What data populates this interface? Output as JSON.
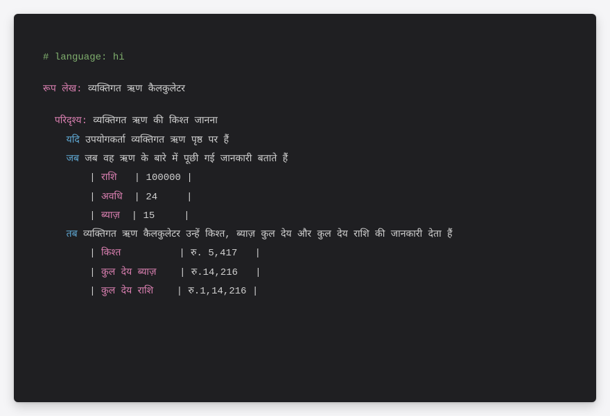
{
  "comment": "# language: hi",
  "feature_kw": "रूप लेख:",
  "feature_title": " व्यक्तिगत ऋण कैलकुलेटर",
  "scenario_kw": "परिदृश्य:",
  "scenario_title": " व्यक्तिगत ऋण की किश्त जानना",
  "given_kw": "यदि",
  "given_text": " उपयोगकर्ता व्यक्तिगत ऋण पृष्ठ पर हैं",
  "when_kw": "जब",
  "when_text": " जब वह ऋण के बारे में पूछी गई जानकारी बताते हैं",
  "table1": {
    "r1": {
      "name": " राशि   ",
      "val": " 100000 "
    },
    "r2": {
      "name": " अवधि  ",
      "val": " 24     "
    },
    "r3": {
      "name": " ब्याज़  ",
      "val": " 15     "
    }
  },
  "then_kw": "तब",
  "then_text": " व्यक्तिगत ऋण कैलकुलेटर उन्हें किश्त, ब्याज़ कुल देय और कुल देय राशि की जानकारी देता हैं",
  "table2": {
    "r1": {
      "name": " किश्त          ",
      "val": " रु. 5,417   "
    },
    "r2": {
      "name": " कुल देय ब्याज़    ",
      "val": " रु.14,216   "
    },
    "r3": {
      "name": " कुल देय राशि    ",
      "val": " रु.1,14,216 "
    }
  },
  "pipe": "|",
  "indent": {
    "scenario": "  ",
    "step": "    ",
    "table": "        "
  }
}
